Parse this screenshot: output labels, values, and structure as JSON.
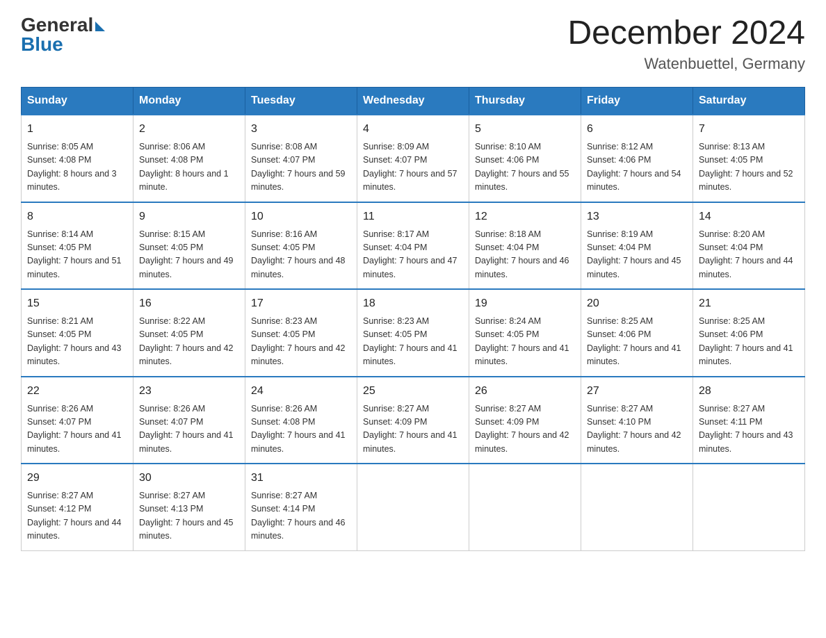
{
  "header": {
    "logo_text_general": "General",
    "logo_text_blue": "Blue",
    "month_title": "December 2024",
    "location": "Watenbuettel, Germany"
  },
  "days_of_week": [
    "Sunday",
    "Monday",
    "Tuesday",
    "Wednesday",
    "Thursday",
    "Friday",
    "Saturday"
  ],
  "weeks": [
    [
      {
        "day": "1",
        "sunrise": "8:05 AM",
        "sunset": "4:08 PM",
        "daylight": "8 hours and 3 minutes."
      },
      {
        "day": "2",
        "sunrise": "8:06 AM",
        "sunset": "4:08 PM",
        "daylight": "8 hours and 1 minute."
      },
      {
        "day": "3",
        "sunrise": "8:08 AM",
        "sunset": "4:07 PM",
        "daylight": "7 hours and 59 minutes."
      },
      {
        "day": "4",
        "sunrise": "8:09 AM",
        "sunset": "4:07 PM",
        "daylight": "7 hours and 57 minutes."
      },
      {
        "day": "5",
        "sunrise": "8:10 AM",
        "sunset": "4:06 PM",
        "daylight": "7 hours and 55 minutes."
      },
      {
        "day": "6",
        "sunrise": "8:12 AM",
        "sunset": "4:06 PM",
        "daylight": "7 hours and 54 minutes."
      },
      {
        "day": "7",
        "sunrise": "8:13 AM",
        "sunset": "4:05 PM",
        "daylight": "7 hours and 52 minutes."
      }
    ],
    [
      {
        "day": "8",
        "sunrise": "8:14 AM",
        "sunset": "4:05 PM",
        "daylight": "7 hours and 51 minutes."
      },
      {
        "day": "9",
        "sunrise": "8:15 AM",
        "sunset": "4:05 PM",
        "daylight": "7 hours and 49 minutes."
      },
      {
        "day": "10",
        "sunrise": "8:16 AM",
        "sunset": "4:05 PM",
        "daylight": "7 hours and 48 minutes."
      },
      {
        "day": "11",
        "sunrise": "8:17 AM",
        "sunset": "4:04 PM",
        "daylight": "7 hours and 47 minutes."
      },
      {
        "day": "12",
        "sunrise": "8:18 AM",
        "sunset": "4:04 PM",
        "daylight": "7 hours and 46 minutes."
      },
      {
        "day": "13",
        "sunrise": "8:19 AM",
        "sunset": "4:04 PM",
        "daylight": "7 hours and 45 minutes."
      },
      {
        "day": "14",
        "sunrise": "8:20 AM",
        "sunset": "4:04 PM",
        "daylight": "7 hours and 44 minutes."
      }
    ],
    [
      {
        "day": "15",
        "sunrise": "8:21 AM",
        "sunset": "4:05 PM",
        "daylight": "7 hours and 43 minutes."
      },
      {
        "day": "16",
        "sunrise": "8:22 AM",
        "sunset": "4:05 PM",
        "daylight": "7 hours and 42 minutes."
      },
      {
        "day": "17",
        "sunrise": "8:23 AM",
        "sunset": "4:05 PM",
        "daylight": "7 hours and 42 minutes."
      },
      {
        "day": "18",
        "sunrise": "8:23 AM",
        "sunset": "4:05 PM",
        "daylight": "7 hours and 41 minutes."
      },
      {
        "day": "19",
        "sunrise": "8:24 AM",
        "sunset": "4:05 PM",
        "daylight": "7 hours and 41 minutes."
      },
      {
        "day": "20",
        "sunrise": "8:25 AM",
        "sunset": "4:06 PM",
        "daylight": "7 hours and 41 minutes."
      },
      {
        "day": "21",
        "sunrise": "8:25 AM",
        "sunset": "4:06 PM",
        "daylight": "7 hours and 41 minutes."
      }
    ],
    [
      {
        "day": "22",
        "sunrise": "8:26 AM",
        "sunset": "4:07 PM",
        "daylight": "7 hours and 41 minutes."
      },
      {
        "day": "23",
        "sunrise": "8:26 AM",
        "sunset": "4:07 PM",
        "daylight": "7 hours and 41 minutes."
      },
      {
        "day": "24",
        "sunrise": "8:26 AM",
        "sunset": "4:08 PM",
        "daylight": "7 hours and 41 minutes."
      },
      {
        "day": "25",
        "sunrise": "8:27 AM",
        "sunset": "4:09 PM",
        "daylight": "7 hours and 41 minutes."
      },
      {
        "day": "26",
        "sunrise": "8:27 AM",
        "sunset": "4:09 PM",
        "daylight": "7 hours and 42 minutes."
      },
      {
        "day": "27",
        "sunrise": "8:27 AM",
        "sunset": "4:10 PM",
        "daylight": "7 hours and 42 minutes."
      },
      {
        "day": "28",
        "sunrise": "8:27 AM",
        "sunset": "4:11 PM",
        "daylight": "7 hours and 43 minutes."
      }
    ],
    [
      {
        "day": "29",
        "sunrise": "8:27 AM",
        "sunset": "4:12 PM",
        "daylight": "7 hours and 44 minutes."
      },
      {
        "day": "30",
        "sunrise": "8:27 AM",
        "sunset": "4:13 PM",
        "daylight": "7 hours and 45 minutes."
      },
      {
        "day": "31",
        "sunrise": "8:27 AM",
        "sunset": "4:14 PM",
        "daylight": "7 hours and 46 minutes."
      },
      null,
      null,
      null,
      null
    ]
  ]
}
